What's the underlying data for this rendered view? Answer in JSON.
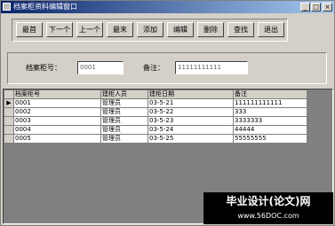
{
  "window": {
    "title": "档案柜资料编辑窗口",
    "controls": {
      "minimize": "_",
      "maximize": "□",
      "close": "×"
    }
  },
  "toolbar": {
    "buttons": [
      "最首",
      "下一个",
      "上一个",
      "最末",
      "添加",
      "编辑",
      "删除",
      "查找",
      "退出"
    ]
  },
  "form": {
    "cabinet_no_label": "档案柜号：",
    "cabinet_no_value": "0001",
    "remark_label": "备注：",
    "remark_value": "11111111111"
  },
  "grid": {
    "columns": [
      "档案柜号",
      "建柜人员",
      "建柜日期",
      "备注"
    ],
    "rows": [
      [
        "0001",
        "管理员",
        "03-5-21",
        "111111111111"
      ],
      [
        "0002",
        "管理员",
        "03-5-22",
        "333"
      ],
      [
        "0003",
        "管理员",
        "03-5-23",
        "3333333"
      ],
      [
        "0004",
        "管理员",
        "03-5-24",
        "44444"
      ],
      [
        "0005",
        "管理员",
        "03-5-25",
        "55555555"
      ]
    ],
    "current_row_indicator": "▶"
  },
  "watermark": {
    "line1": "毕业设计(论文)网",
    "line2": "www.56DOC.com"
  }
}
